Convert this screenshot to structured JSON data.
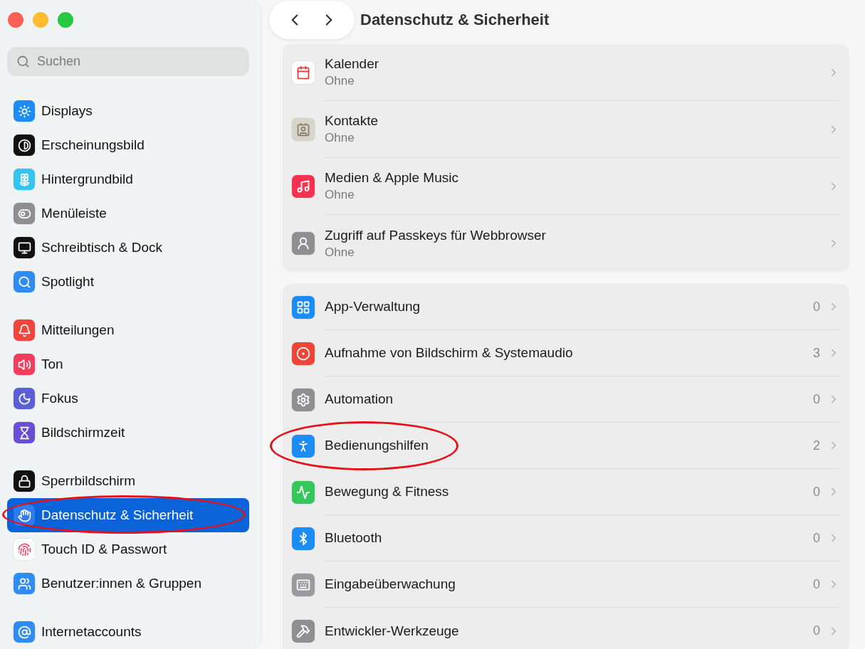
{
  "sidebar": {
    "search": {
      "placeholder": "Suchen"
    },
    "groups": [
      {
        "items": [
          {
            "label": "Displays",
            "selected": false,
            "circled": false
          },
          {
            "label": "Erscheinungsbild",
            "selected": false,
            "circled": false
          },
          {
            "label": "Hintergrundbild",
            "selected": false,
            "circled": false
          },
          {
            "label": "Menüleiste",
            "selected": false,
            "circled": false
          },
          {
            "label": "Schreibtisch & Dock",
            "selected": false,
            "circled": false
          },
          {
            "label": "Spotlight",
            "selected": false,
            "circled": false
          }
        ]
      },
      {
        "items": [
          {
            "label": "Mitteilungen",
            "selected": false,
            "circled": false
          },
          {
            "label": "Ton",
            "selected": false,
            "circled": false
          },
          {
            "label": "Fokus",
            "selected": false,
            "circled": false
          },
          {
            "label": "Bildschirmzeit",
            "selected": false,
            "circled": false
          }
        ]
      },
      {
        "items": [
          {
            "label": "Sperrbildschirm",
            "selected": false,
            "circled": false
          },
          {
            "label": "Datenschutz & Sicherheit",
            "selected": true,
            "circled": true
          },
          {
            "label": "Touch ID & Passwort",
            "selected": false,
            "circled": false
          },
          {
            "label": "Benutzer:innen & Gruppen",
            "selected": false,
            "circled": false
          }
        ]
      },
      {
        "items": [
          {
            "label": "Internetaccounts",
            "selected": false,
            "circled": false
          }
        ]
      }
    ]
  },
  "header": {
    "title": "Datenschutz & Sicherheit"
  },
  "sections": [
    {
      "rows": [
        {
          "title": "Kalender",
          "subtitle": "Ohne",
          "circled": false
        },
        {
          "title": "Kontakte",
          "subtitle": "Ohne",
          "circled": false
        },
        {
          "title": "Medien & Apple Music",
          "subtitle": "Ohne",
          "circled": false
        },
        {
          "title": "Zugriff auf Passkeys für Webbrowser",
          "subtitle": "Ohne",
          "circled": false
        }
      ]
    },
    {
      "rows": [
        {
          "title": "App-Verwaltung",
          "count": "0",
          "circled": false
        },
        {
          "title": "Aufnahme von Bildschirm & Systemaudio",
          "count": "3",
          "circled": false
        },
        {
          "title": "Automation",
          "count": "0",
          "circled": false
        },
        {
          "title": "Bedienungshilfen",
          "count": "2",
          "circled": true
        },
        {
          "title": "Bewegung & Fitness",
          "count": "0",
          "circled": false
        },
        {
          "title": "Bluetooth",
          "count": "0",
          "circled": false
        },
        {
          "title": "Eingabeüberwachung",
          "count": "0",
          "circled": false
        },
        {
          "title": "Entwickler-Werkzeuge",
          "count": "0",
          "circled": false
        }
      ]
    }
  ]
}
